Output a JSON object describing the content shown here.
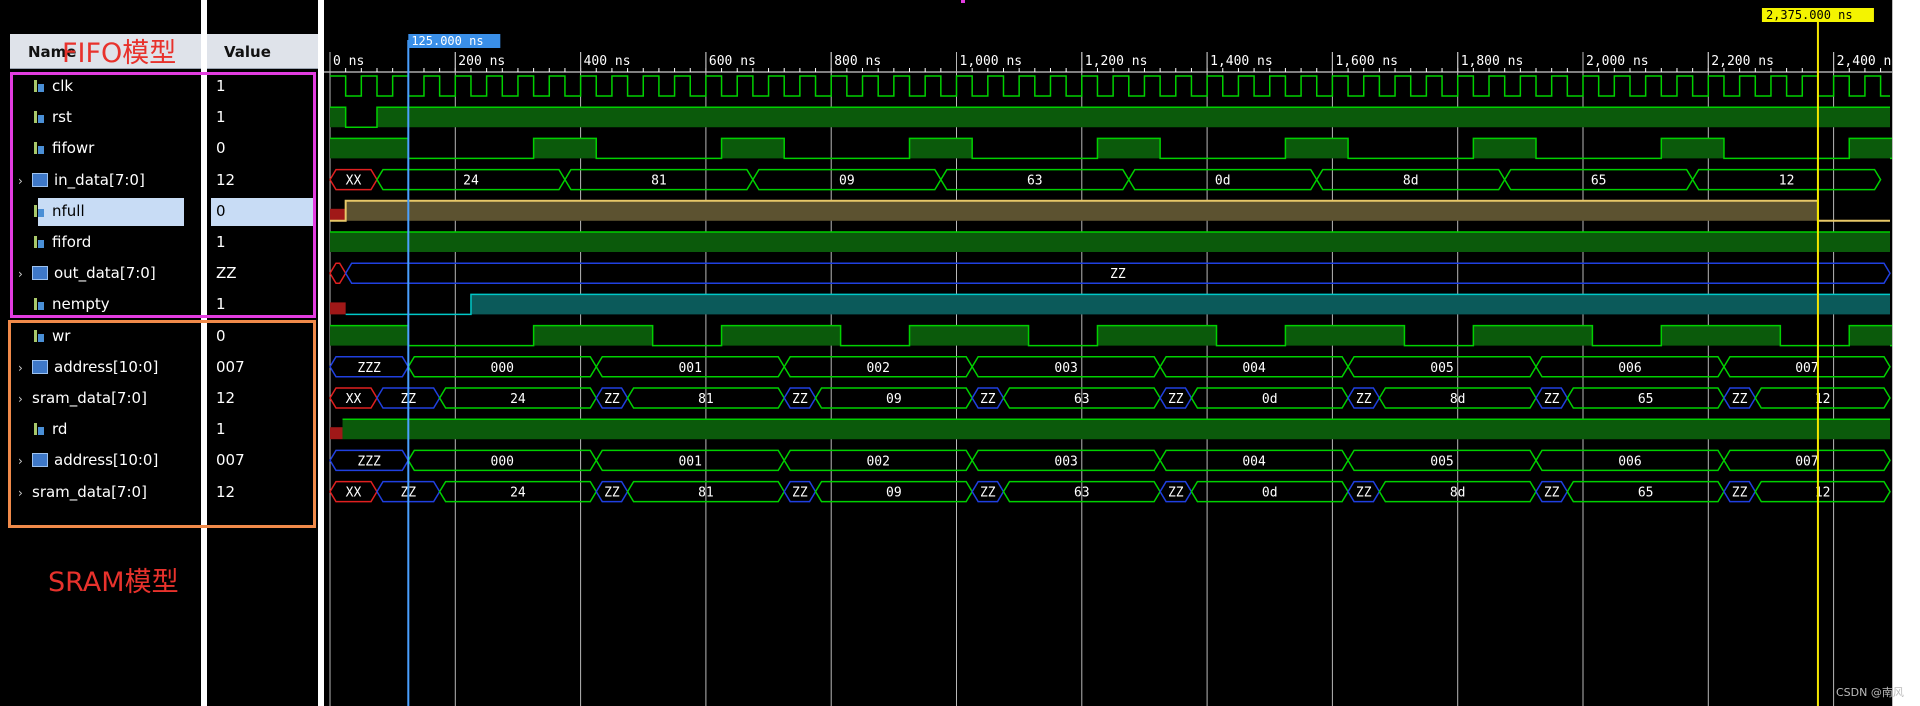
{
  "header": {
    "name_label": "Name",
    "value_label": "Value"
  },
  "annotations": {
    "fifo_label": "FIFO模型",
    "sram_label": "SRAM模型"
  },
  "cursors": {
    "blue_label": "125.000 ns",
    "yellow_label": "2,375.000 ns",
    "blue_time": 125,
    "yellow_time": 2375
  },
  "timeline": {
    "range_ns": [
      0,
      2500
    ],
    "ticks": [
      "0 ns",
      "200 ns",
      "400 ns",
      "600 ns",
      "800 ns",
      "1,000 ns",
      "1,200 ns",
      "1,400 ns",
      "1,600 ns",
      "1,800 ns",
      "2,000 ns",
      "2,200 ns",
      "2,400 ns"
    ],
    "tick_values": [
      0,
      200,
      400,
      600,
      800,
      1000,
      1200,
      1400,
      1600,
      1800,
      2000,
      2200,
      2400
    ]
  },
  "signals": [
    {
      "id": "clk",
      "name": "clk",
      "value": "1",
      "type": "bit",
      "color": "#00d000"
    },
    {
      "id": "rst",
      "name": "rst",
      "value": "1",
      "type": "bit",
      "color": "#00d000"
    },
    {
      "id": "fifowr",
      "name": "fifowr",
      "value": "0",
      "type": "bit",
      "color": "#00d000"
    },
    {
      "id": "in_data",
      "name": "in_data[7:0]",
      "value": "12",
      "type": "bus",
      "expandable": true,
      "segments": [
        "XX",
        "24",
        "81",
        "09",
        "63",
        "0d",
        "8d",
        "65",
        "12"
      ]
    },
    {
      "id": "nfull",
      "name": "nfull",
      "value": "0",
      "type": "bit",
      "selected": true,
      "color": "#e8c868"
    },
    {
      "id": "fiford",
      "name": "fiford",
      "value": "1",
      "type": "bit",
      "color": "#00d000"
    },
    {
      "id": "out_data",
      "name": "out_data[7:0]",
      "value": "ZZ",
      "type": "bus",
      "expandable": true,
      "segments": [
        "ZZ"
      ]
    },
    {
      "id": "nempty",
      "name": "nempty",
      "value": "1",
      "type": "bit",
      "color": "#00c8c8"
    },
    {
      "id": "wr",
      "name": "wr",
      "value": "0",
      "type": "bit",
      "color": "#00d000"
    },
    {
      "id": "address_w",
      "name": "address[10:0]",
      "value": "007",
      "type": "bus",
      "expandable": true,
      "segments": [
        "ZZZ",
        "000",
        "001",
        "002",
        "003",
        "004",
        "005",
        "006",
        "007"
      ]
    },
    {
      "id": "sram_data_w",
      "name": "sram_data[7:0]",
      "value": "12",
      "type": "bus",
      "expandable": true,
      "segments": [
        "XX",
        "ZZ",
        "24",
        "ZZ",
        "81",
        "ZZ",
        "09",
        "ZZ",
        "63",
        "ZZ",
        "0d",
        "ZZ",
        "8d",
        "ZZ",
        "65",
        "ZZ",
        "12"
      ]
    },
    {
      "id": "rd",
      "name": "rd",
      "value": "1",
      "type": "bit",
      "color": "#00d000"
    },
    {
      "id": "address_r",
      "name": "address[10:0]",
      "value": "007",
      "type": "bus",
      "expandable": true,
      "segments": [
        "ZZZ",
        "000",
        "001",
        "002",
        "003",
        "004",
        "005",
        "006",
        "007"
      ]
    },
    {
      "id": "sram_data_r",
      "name": "sram_data[7:0]",
      "value": "12",
      "type": "bus",
      "expandable": true,
      "segments": [
        "XX",
        "ZZ",
        "24",
        "ZZ",
        "81",
        "ZZ",
        "09",
        "ZZ",
        "63",
        "ZZ",
        "0d",
        "ZZ",
        "8d",
        "ZZ",
        "65",
        "ZZ",
        "12"
      ]
    }
  ],
  "watermark": "CSDN @南风"
}
